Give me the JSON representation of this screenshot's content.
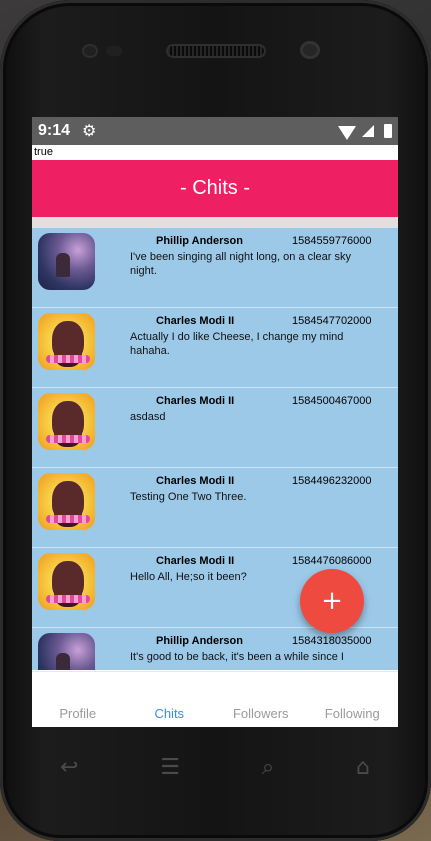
{
  "status": {
    "time": "9:14",
    "gear_icon": "gear-icon"
  },
  "debug": {
    "text": "true"
  },
  "header": {
    "title": "- Chits -"
  },
  "chits": [
    {
      "name": "Phillip Anderson",
      "ts": "1584559776000",
      "msg": "I've been singing all night long, on a clear sky night.",
      "avatar": "sky"
    },
    {
      "name": "Charles Modi II",
      "ts": "1584547702000",
      "msg": "Actually I do like Cheese, I change my mind hahaha.",
      "avatar": "bob"
    },
    {
      "name": "Charles Modi II",
      "ts": "1584500467000",
      "msg": "asdasd",
      "avatar": "bob"
    },
    {
      "name": "Charles Modi II",
      "ts": "1584496232000",
      "msg": "Testing One Two Three.",
      "avatar": "bob"
    },
    {
      "name": "Charles Modi II",
      "ts": "1584476086000",
      "msg": "Hello All, He;so it been?",
      "avatar": "bob"
    },
    {
      "name": "Phillip Anderson",
      "ts": "1584318035000",
      "msg": "It's good to be back, it's been a while since I",
      "avatar": "sky"
    }
  ],
  "fab": {
    "label": "+"
  },
  "nav": {
    "profile": "Profile",
    "chits": "Chits",
    "followers": "Followers",
    "following": "Following"
  },
  "colors": {
    "header": "#ef1f64",
    "chit_bg": "#9dc9e9",
    "fab": "#ef4a3f",
    "nav_active": "#3b8fe0"
  }
}
